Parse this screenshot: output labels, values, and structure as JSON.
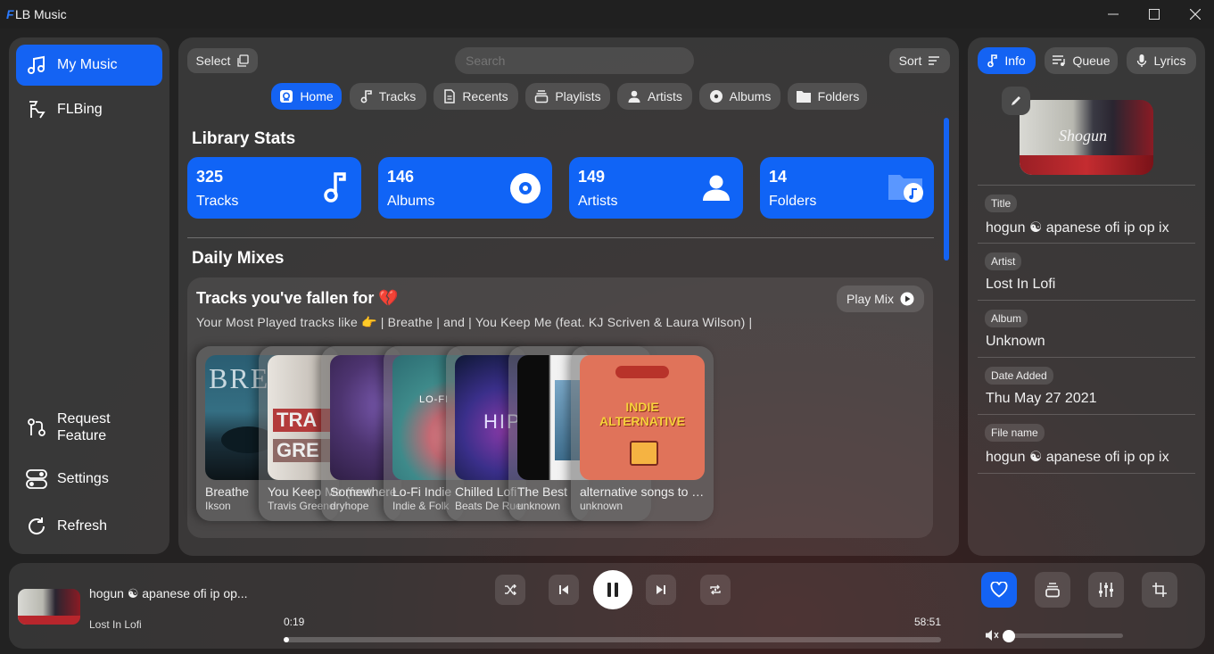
{
  "window": {
    "logo": "F",
    "title": "LB Music"
  },
  "sidebar": {
    "items": [
      {
        "label": "My Music",
        "icon": "music-note-icon",
        "active": true
      },
      {
        "label": "FLBing",
        "icon": "flbing-icon"
      }
    ],
    "bottom": [
      {
        "label": "Request Feature",
        "icon": "request-icon"
      },
      {
        "label": "Settings",
        "icon": "toggle-icon"
      },
      {
        "label": "Refresh",
        "icon": "refresh-icon"
      }
    ]
  },
  "toolbar": {
    "select_label": "Select",
    "search_placeholder": "Search",
    "sort_label": "Sort"
  },
  "tabs": [
    "Home",
    "Tracks",
    "Recents",
    "Playlists",
    "Artists",
    "Albums",
    "Folders"
  ],
  "library": {
    "title": "Library Stats",
    "stats": [
      {
        "value": "325",
        "label": "Tracks",
        "icon": "music-note-icon"
      },
      {
        "value": "146",
        "label": "Albums",
        "icon": "disc-icon"
      },
      {
        "value": "149",
        "label": "Artists",
        "icon": "person-icon"
      },
      {
        "value": "14",
        "label": "Folders",
        "icon": "folder-music-icon"
      }
    ]
  },
  "mixes": {
    "title": "Daily Mixes",
    "card_title": "Tracks you've fallen for 💔",
    "play_label": "Play Mix",
    "subtitle": "Your Most Played tracks like 👉 | Breathe | and | You Keep Me (feat. KJ Scriven & Laura Wilson) |",
    "tracks": [
      {
        "title": "Breathe",
        "artist": "Ikson"
      },
      {
        "title": "You Keep Me (feat. KJ Scriven & Laura Wilson)",
        "artist": "Travis Greene"
      },
      {
        "title": "Somewhere",
        "artist": "dryhope"
      },
      {
        "title": "Lo-Fi Indie",
        "artist": "Indie & Folk"
      },
      {
        "title": "Chilled Lofi",
        "artist": "Beats De Rue"
      },
      {
        "title": "The Best",
        "artist": "unknown"
      },
      {
        "title": "alternative songs to …",
        "artist": "unknown"
      }
    ]
  },
  "right_tabs": [
    {
      "label": "Info",
      "active": true
    },
    {
      "label": "Queue"
    },
    {
      "label": "Lyrics"
    }
  ],
  "info": {
    "fields": [
      {
        "key": "Title",
        "value": "hogun ☯ apanese ofi ip op ix"
      },
      {
        "key": "Artist",
        "value": "Lost In Lofi"
      },
      {
        "key": "Album",
        "value": "Unknown"
      },
      {
        "key": "Date Added",
        "value": "Thu May 27 2021"
      },
      {
        "key": "File name",
        "value": "hogun ☯ apanese ofi ip op ix"
      }
    ],
    "art_text": "Shogun"
  },
  "player": {
    "title": "hogun ☯ apanese ofi ip op...",
    "artist": "Lost In Lofi",
    "elapsed": "0:19",
    "duration": "58:51",
    "progress": 0.005,
    "volume": 0.0
  },
  "colors": {
    "accent": "#1463f3",
    "stat_bg": "#1064f6",
    "title_bar": "#202020"
  }
}
